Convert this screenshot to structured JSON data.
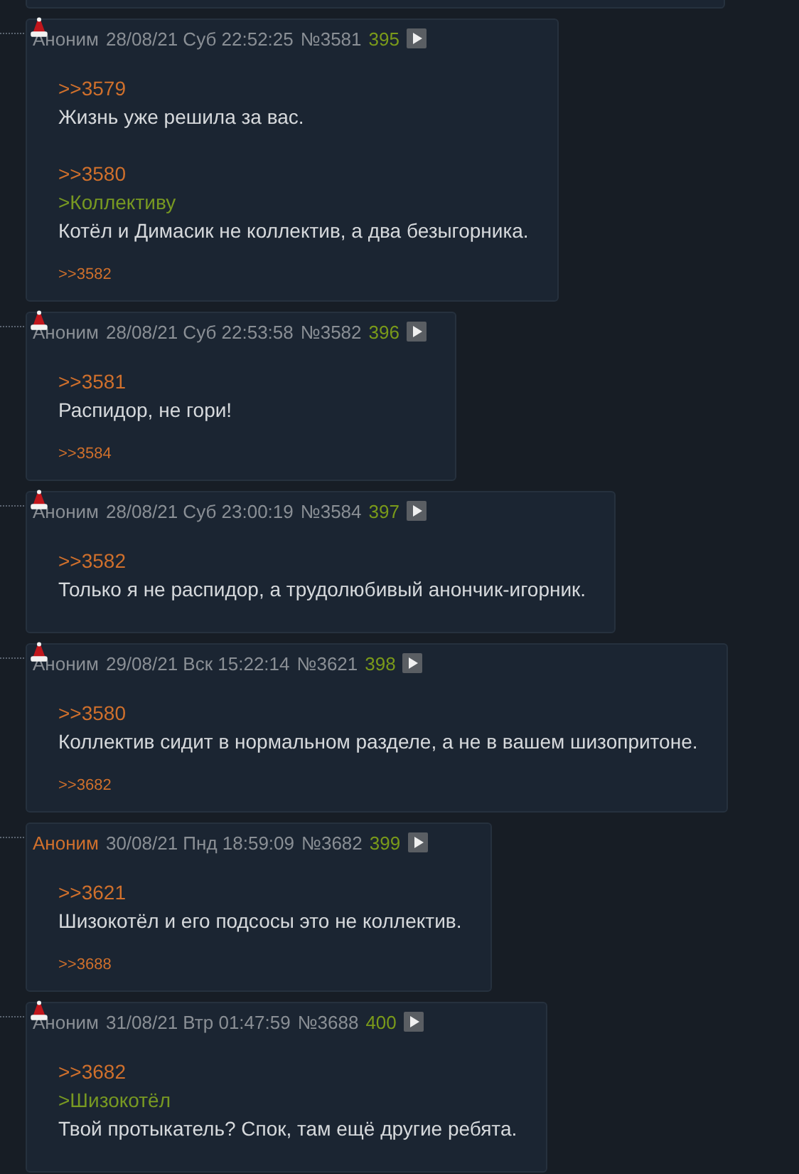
{
  "posts": [
    {
      "name": "Аноним",
      "op": false,
      "hat": true,
      "date": "28/08/21 Суб 22:52:25",
      "number": "№3581",
      "index": "395",
      "lines": [
        {
          "kind": "link",
          "text": ">>3579"
        },
        {
          "kind": "text",
          "text": "Жизнь уже решила за вас."
        },
        {
          "kind": "blank"
        },
        {
          "kind": "link",
          "text": ">>3580"
        },
        {
          "kind": "quote",
          "text": ">Коллективу"
        },
        {
          "kind": "text",
          "text": "Котёл и Димасик не коллектив, а два безыгорника."
        }
      ],
      "replies": [
        ">>3582"
      ]
    },
    {
      "name": "Аноним",
      "op": false,
      "hat": true,
      "date": "28/08/21 Суб 22:53:58",
      "number": "№3582",
      "index": "396",
      "lines": [
        {
          "kind": "link",
          "text": ">>3581"
        },
        {
          "kind": "text",
          "text": "Распидор, не гори!"
        }
      ],
      "replies": [
        ">>3584"
      ]
    },
    {
      "name": "Аноним",
      "op": false,
      "hat": true,
      "date": "28/08/21 Суб 23:00:19",
      "number": "№3584",
      "index": "397",
      "lines": [
        {
          "kind": "link",
          "text": ">>3582"
        },
        {
          "kind": "text",
          "text": "Только я не распидор, а трудолюбивый анончик-игорник."
        }
      ]
    },
    {
      "name": "Аноним",
      "op": false,
      "hat": true,
      "date": "29/08/21 Вск 15:22:14",
      "number": "№3621",
      "index": "398",
      "lines": [
        {
          "kind": "link",
          "text": ">>3580"
        },
        {
          "kind": "text",
          "text": "Коллектив сидит в нормальном разделе, а не в вашем шизопритоне."
        }
      ],
      "replies": [
        ">>3682"
      ]
    },
    {
      "name": "Аноним",
      "op": true,
      "hat": false,
      "date": "30/08/21 Пнд 18:59:09",
      "number": "№3682",
      "index": "399",
      "lines": [
        {
          "kind": "link",
          "text": ">>3621"
        },
        {
          "kind": "text",
          "text": "Шизокотёл и его подсосы это не коллектив."
        }
      ],
      "replies": [
        ">>3688"
      ]
    },
    {
      "name": "Аноним",
      "op": false,
      "hat": true,
      "date": "31/08/21 Втр 01:47:59",
      "number": "№3688",
      "index": "400",
      "lines": [
        {
          "kind": "link",
          "text": ">>3682"
        },
        {
          "kind": "quote",
          "text": ">Шизокотёл"
        },
        {
          "kind": "text",
          "text": "Твой протыкатель? Спок, там ещё другие ребята."
        }
      ]
    }
  ]
}
